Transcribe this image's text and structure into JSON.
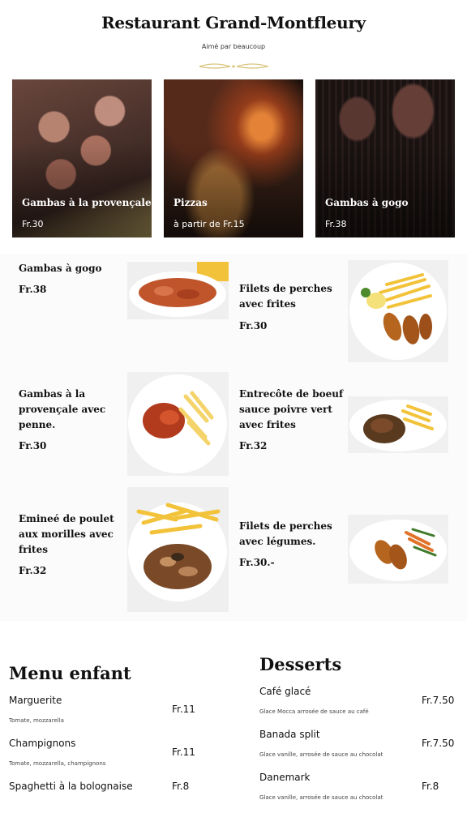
{
  "header": {
    "title": "Restaurant Grand-Montfleury",
    "subtitle": "Aimé par beaucoup"
  },
  "featured": [
    {
      "name": "Gambas à la provençale",
      "price": "Fr.30"
    },
    {
      "name": "Pizzas",
      "price": "à partir de Fr.15"
    },
    {
      "name": "Gambas à gogo",
      "price": "Fr.38"
    }
  ],
  "dishes": {
    "d1": {
      "name": "Gambas à gogo",
      "price": "Fr.38"
    },
    "d2": {
      "name_l1": "Filets de perches",
      "name_l2": "avec frites",
      "price": "Fr.30"
    },
    "d3": {
      "name_l1": "Gambas à la",
      "name_l2": "provençale avec",
      "name_l3": "penne.",
      "price": "Fr.30"
    },
    "d4": {
      "name_l1": "Entrecôte de boeuf",
      "name_l2": "sauce poivre vert",
      "name_l3": "avec frites",
      "price": "Fr.32"
    },
    "d5": {
      "name_l1": "Emineé de poulet",
      "name_l2": "aux morilles avec",
      "name_l3": "frites",
      "price": "Fr.32"
    },
    "d6": {
      "name_l1": "Filets de perches",
      "name_l2": "avec légumes.",
      "price": "Fr.30.-"
    }
  },
  "kids_menu": {
    "title": "Menu enfant",
    "items": [
      {
        "name": "Marguerite",
        "desc": "Tomate, mozzarella",
        "price": "Fr.11"
      },
      {
        "name": "Champignons",
        "desc": "Tomate, mozzarella, champignons",
        "price": "Fr.11"
      },
      {
        "name": "Spaghetti à la bolognaise",
        "desc": "",
        "price": "Fr.8"
      }
    ]
  },
  "desserts": {
    "title": "Desserts",
    "items": [
      {
        "name": "Café glacé",
        "desc": "Glace Mocca arrosée de sauce au café",
        "price": "Fr.7.50"
      },
      {
        "name": "Banada split",
        "desc": "Glace vanille, arrosée de sauce au chocolat",
        "price": "Fr.7.50"
      },
      {
        "name": "Danemark",
        "desc": "Glace vanille, arrosée de sauce au chocolat",
        "price": "Fr.8"
      }
    ]
  },
  "colors": {
    "accent_gold": "#d8c37a",
    "text": "#111111",
    "section_bg": "#fbfbfb"
  }
}
